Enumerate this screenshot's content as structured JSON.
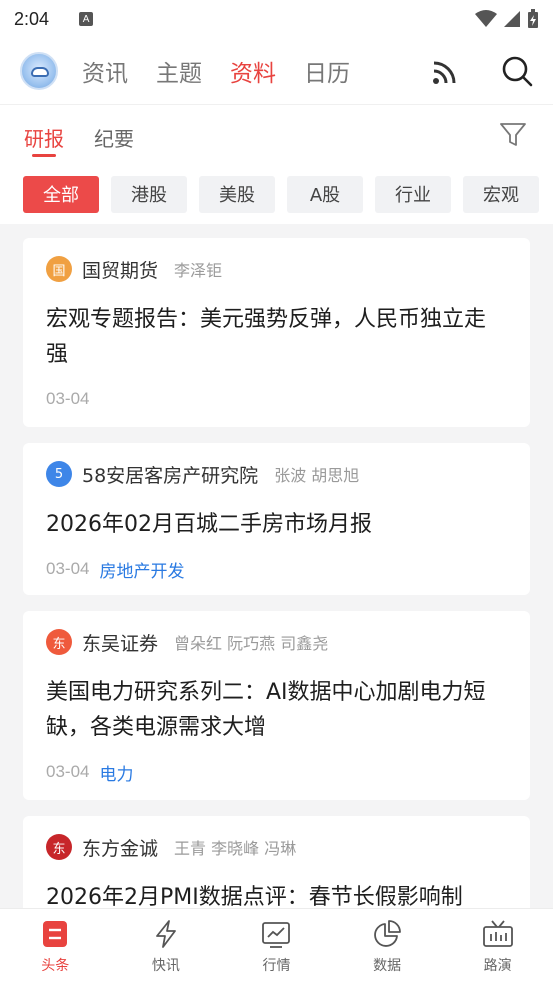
{
  "status_bar": {
    "time": "2:04",
    "a_icon": "A"
  },
  "top_nav": {
    "tabs": [
      {
        "label": "资讯",
        "active": false
      },
      {
        "label": "主题",
        "active": false
      },
      {
        "label": "资料",
        "active": true
      },
      {
        "label": "日历",
        "active": false
      }
    ]
  },
  "sub_tabs": [
    {
      "label": "研报",
      "active": true
    },
    {
      "label": "纪要",
      "active": false
    }
  ],
  "chips": [
    {
      "label": "全部",
      "active": true
    },
    {
      "label": "港股",
      "active": false
    },
    {
      "label": "美股",
      "active": false
    },
    {
      "label": "A股",
      "active": false
    },
    {
      "label": "行业",
      "active": false
    },
    {
      "label": "宏观",
      "active": false
    }
  ],
  "cards": [
    {
      "badge": "国",
      "badge_color": "#f0a042",
      "source": "国贸期货",
      "authors": "李泽钜",
      "title": "宏观专题报告：美元强势反弹，人民币独立走强",
      "date": "03-04",
      "tag": ""
    },
    {
      "badge": "5",
      "badge_color": "#3e86e8",
      "source": "58安居客房产研究院",
      "authors": "张波 胡思旭",
      "title": "2026年02月百城二手房市场月报",
      "date": "03-04",
      "tag": "房地产开发"
    },
    {
      "badge": "东",
      "badge_color": "#ef5a3c",
      "source": "东吴证券",
      "authors": "曾朵红 阮巧燕 司鑫尧",
      "title": "美国电力研究系列二：AI数据中心加剧电力短缺，各类电源需求大增",
      "date": "03-04",
      "tag": "电力"
    },
    {
      "badge": "东",
      "badge_color": "#c7262a",
      "source": "东方金诚",
      "authors": "王青 李晓峰 冯琳",
      "title": "2026年2月PMI数据点评：春节长假影响制",
      "date": "",
      "tag": ""
    }
  ],
  "bottom_bar": [
    {
      "label": "头条",
      "icon": "headline-icon",
      "active": true
    },
    {
      "label": "快讯",
      "icon": "lightning-icon",
      "active": false
    },
    {
      "label": "行情",
      "icon": "chart-icon",
      "active": false
    },
    {
      "label": "数据",
      "icon": "pie-icon",
      "active": false
    },
    {
      "label": "路演",
      "icon": "tv-icon",
      "active": false
    }
  ],
  "colors": {
    "accent": "#e8433f",
    "link": "#2a7ae2"
  }
}
